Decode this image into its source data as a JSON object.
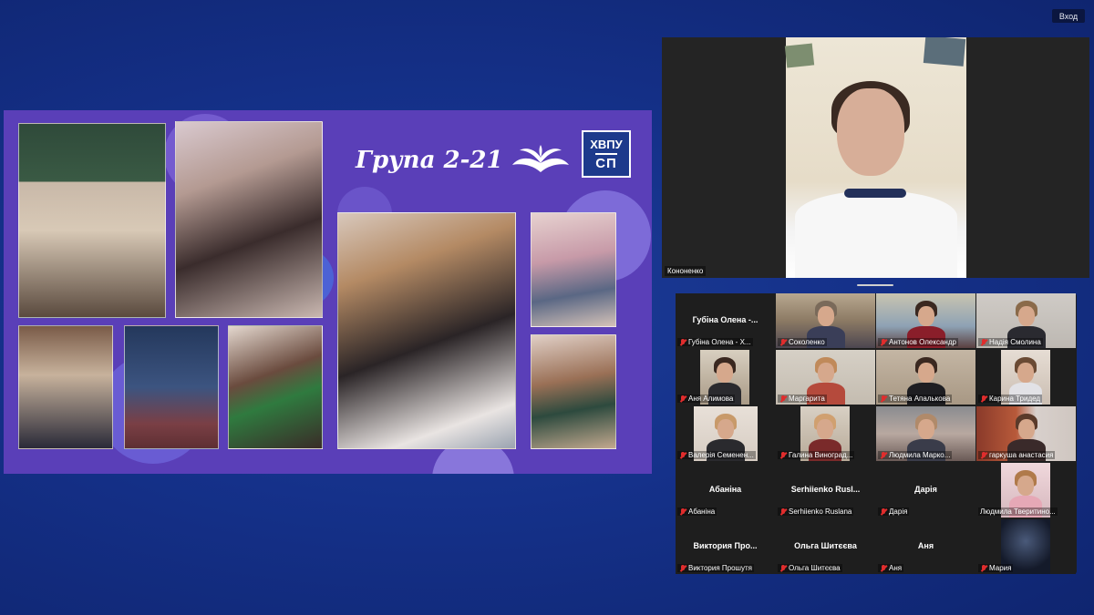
{
  "header": {
    "login_label": "Вход"
  },
  "slide": {
    "title": "Група 2-21",
    "emblem_line1": "ХВПУ",
    "emblem_line2": "СП"
  },
  "speaker": {
    "name": "Кононенко"
  },
  "gallery": {
    "tiles": [
      {
        "center": "Губіна Олена -...",
        "label": "Губіна Олена - Х..."
      },
      {
        "label": "Соколенко"
      },
      {
        "label": "Антонов Олександр"
      },
      {
        "label": "Надія Смолина"
      },
      {
        "label": "Аня Алимова"
      },
      {
        "label": "Маргарита"
      },
      {
        "label": "Тетяна Апалькова"
      },
      {
        "label": "Карина Тридед"
      },
      {
        "label": "Валерія Семенен..."
      },
      {
        "label": "Галина Виноград..."
      },
      {
        "label": "Людмила Марко..."
      },
      {
        "label": "гаркуша анастасия"
      },
      {
        "center": "Абаніна",
        "label": "Абаніна"
      },
      {
        "center": "Serhiienko Rusl...",
        "label": "Serhiienko Ruslana"
      },
      {
        "center": "Дарія",
        "label": "Дарія"
      },
      {
        "label": "Людмила Тверитино..."
      },
      {
        "center": "Виктория Про...",
        "label": "Виктория Прошутя"
      },
      {
        "center": "Ольга Шитєєва",
        "label": "Ольга Шитєєва"
      },
      {
        "center": "Аня",
        "label": "Аня"
      },
      {
        "label": "Мария"
      }
    ]
  },
  "colors": {
    "background": "#15318a",
    "slide": "#5a3fb8",
    "tile": "#1e1e1e",
    "mic_muted": "#e02d2d"
  }
}
